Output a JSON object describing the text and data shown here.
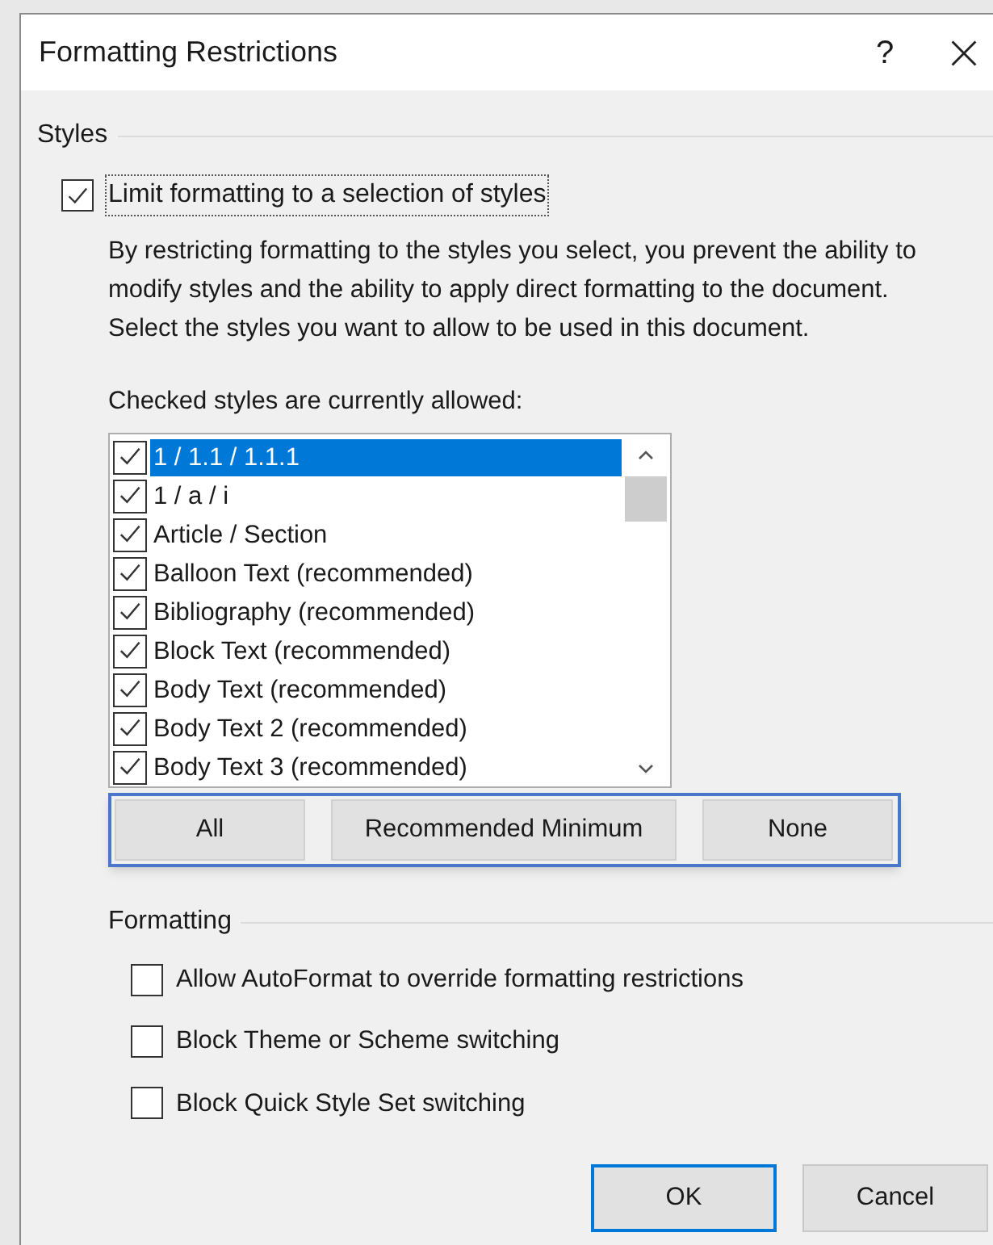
{
  "window": {
    "title": "Formatting Restrictions",
    "help": "?"
  },
  "styles_section": {
    "heading": "Styles",
    "limit_checkbox": {
      "label": "Limit formatting to a selection of styles",
      "checked": true
    },
    "description": [
      "By restricting formatting to the styles you select, you prevent the ability to",
      "modify styles and the ability to apply direct formatting to the document.",
      "Select the styles you want to allow to be used in this document."
    ],
    "list_label": "Checked styles are currently allowed:",
    "styles": [
      {
        "label": "1 / 1.1 / 1.1.1",
        "checked": true,
        "selected": true
      },
      {
        "label": "1 / a / i",
        "checked": true,
        "selected": false
      },
      {
        "label": "Article / Section",
        "checked": true,
        "selected": false
      },
      {
        "label": "Balloon Text (recommended)",
        "checked": true,
        "selected": false
      },
      {
        "label": "Bibliography (recommended)",
        "checked": true,
        "selected": false
      },
      {
        "label": "Block Text (recommended)",
        "checked": true,
        "selected": false
      },
      {
        "label": "Body Text (recommended)",
        "checked": true,
        "selected": false
      },
      {
        "label": "Body Text 2 (recommended)",
        "checked": true,
        "selected": false
      },
      {
        "label": "Body Text 3 (recommended)",
        "checked": true,
        "selected": false
      }
    ],
    "buttons": [
      "All",
      "Recommended Minimum",
      "None"
    ]
  },
  "formatting_section": {
    "heading": "Formatting",
    "options": [
      {
        "label": "Allow AutoFormat to override formatting restrictions",
        "checked": false
      },
      {
        "label": "Block Theme or Scheme switching",
        "checked": false
      },
      {
        "label": "Block Quick Style Set switching",
        "checked": false
      }
    ]
  },
  "footer_buttons": [
    {
      "label": "OK",
      "default": true
    },
    {
      "label": "Cancel",
      "default": false
    }
  ]
}
